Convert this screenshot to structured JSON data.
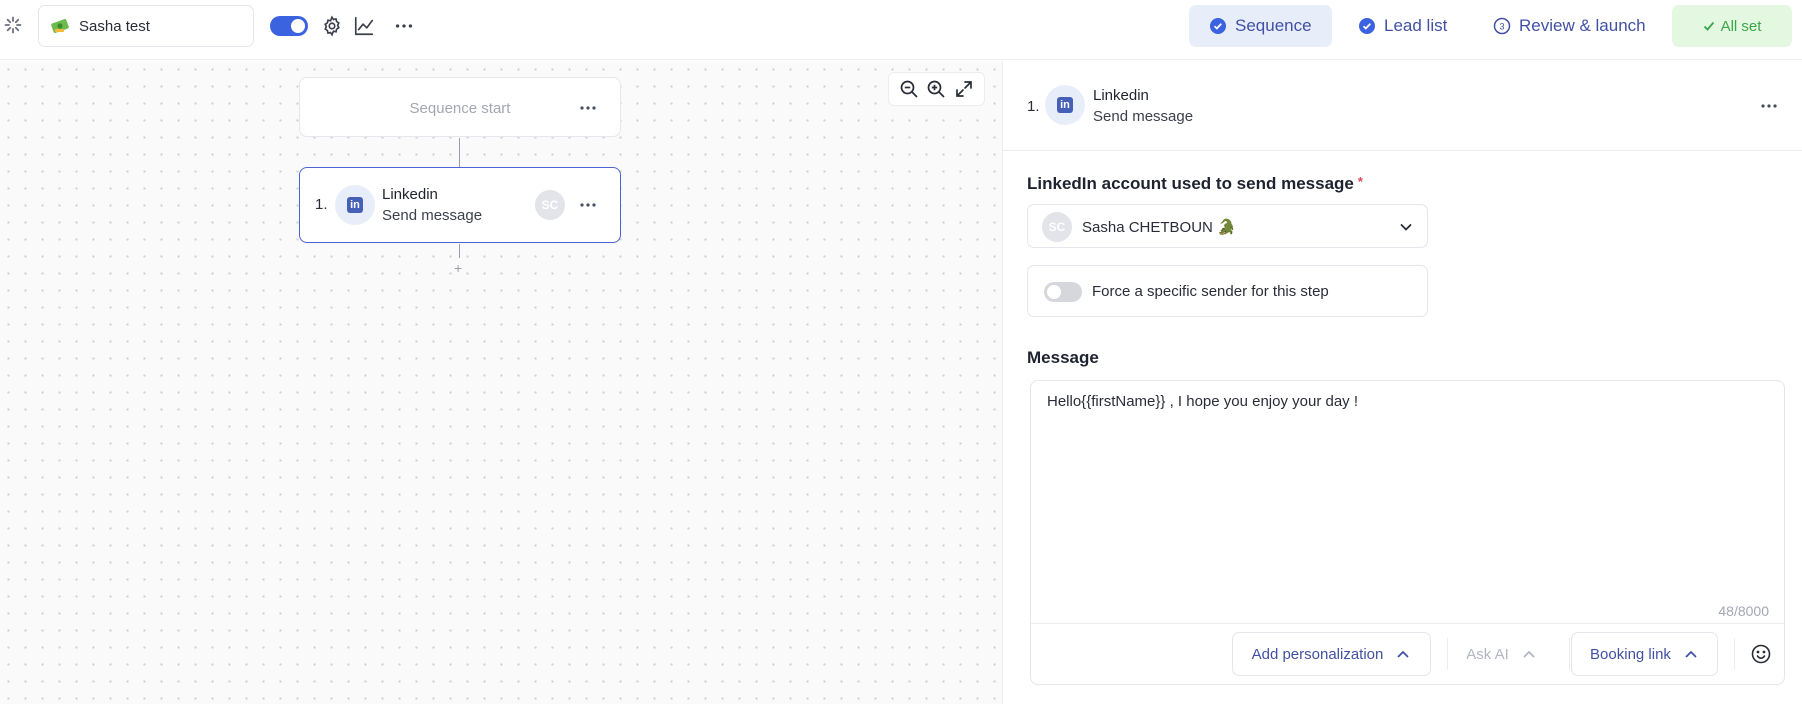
{
  "topbar": {
    "sequence_name": "Sasha test",
    "tabs": [
      {
        "label": "Sequence",
        "active": true
      },
      {
        "label": "Lead list",
        "active": false
      },
      {
        "label": "Review & launch",
        "active": false
      }
    ],
    "status_label": "All set",
    "accent_color": "#3b63e0",
    "status_color": "#3aa64a"
  },
  "canvas": {
    "start_label": "Sequence start",
    "step": {
      "number": "1.",
      "title": "Linkedin",
      "subtitle": "Send message",
      "avatar_initials": "SC",
      "channel_glyph": "in"
    },
    "plus_label": "+"
  },
  "panel": {
    "step_number": "1.",
    "step_title": "Linkedin",
    "step_subtitle": "Send message",
    "account_label": "LinkedIn account used to send message",
    "required_mark": "*",
    "account_avatar": "SC",
    "account_value": "Sasha CHETBOUN 🐊",
    "force_sender_label": "Force a specific sender for this step",
    "force_sender_enabled": false,
    "message_label": "Message",
    "message_text": "Hello{{firstName}} , I hope you enjoy your day !",
    "char_count": "48/8000",
    "footer_buttons": {
      "personalization": "Add personalization",
      "ask_ai": "Ask AI",
      "booking_link": "Booking link"
    }
  }
}
